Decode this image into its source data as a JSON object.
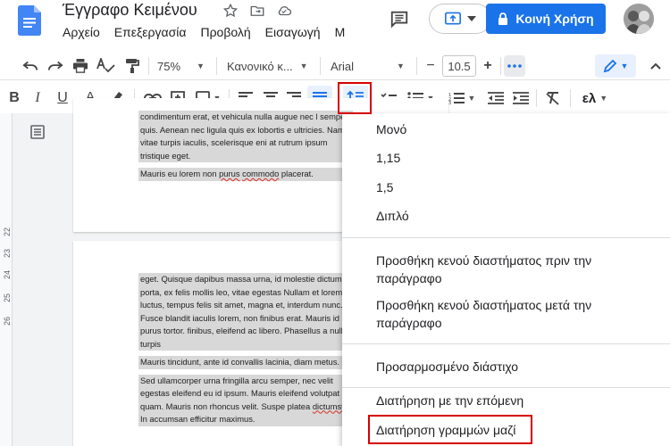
{
  "header": {
    "title": "Έγγραφο Κειμένου",
    "menu": [
      "Αρχείο",
      "Επεξεργασία",
      "Προβολή",
      "Εισαγωγή",
      "Μ"
    ],
    "share_label": "Κοινή Χρήση"
  },
  "toolbar": {
    "zoom": "75%",
    "style": "Κανονικό κ...",
    "font": "Arial",
    "font_size": "10.5",
    "minus": "−",
    "plus": "+",
    "input_tools": "ελ"
  },
  "ruler": {
    "marks": [
      "22",
      "23",
      "24",
      "25",
      "26"
    ]
  },
  "document": {
    "page1_para1": "condimentum erat, et vehicula nulla augue nec l semper quis. Aenean nec ligula quis ex lobortis e ultricies. Nam vitae turpis iaculis, scelerisque eni at rutrum ipsum tristique eget.",
    "page1_para2_pre": "Mauris eu lorem non ",
    "page1_para2_w1": "purus",
    "page1_para2_mid": " ",
    "page1_para2_w2": "commodo",
    "page1_para2_post": " placerat.",
    "page2_para1": "eget. Quisque dapibus massa urna, id molestie dictum porta, ex felis mollis leo, vitae egestas Nullam et lorem luctus, tempus felis sit amet, magna et, interdum nunc. Fusce blandit iaculis lorem, non finibus erat. Mauris id purus tortor. finibus, eleifend ac libero. Phasellus a nulla turpis",
    "page2_para2": "Mauris tincidunt, ante  id convallis lacinia, diam metus.",
    "page2_para3_pre": "Sed ullamcorper urna fringilla arcu semper, nec velit egestas eleifend eu id ipsum. Mauris eleifend volutpat quam. Mauris non rhoncus velit. Suspe platea ",
    "page2_para3_w": "dictumst",
    "page2_para3_post": ". In accumsan efficitur maximus."
  },
  "line_spacing_menu": {
    "items": [
      "Μονό",
      "1,15",
      "1,5",
      "Διπλό",
      "Προσθήκη κενού διαστήματος πριν την παράγραφο",
      "Προσθήκη κενού διαστήματος μετά την παράγραφο",
      "Προσαρμοσμένο διάστιχο",
      "Διατήρηση με την επόμενη",
      "Διατήρηση γραμμών μαζί"
    ]
  },
  "colors": {
    "accent": "#1a73e8",
    "highlight": "#d50000"
  }
}
